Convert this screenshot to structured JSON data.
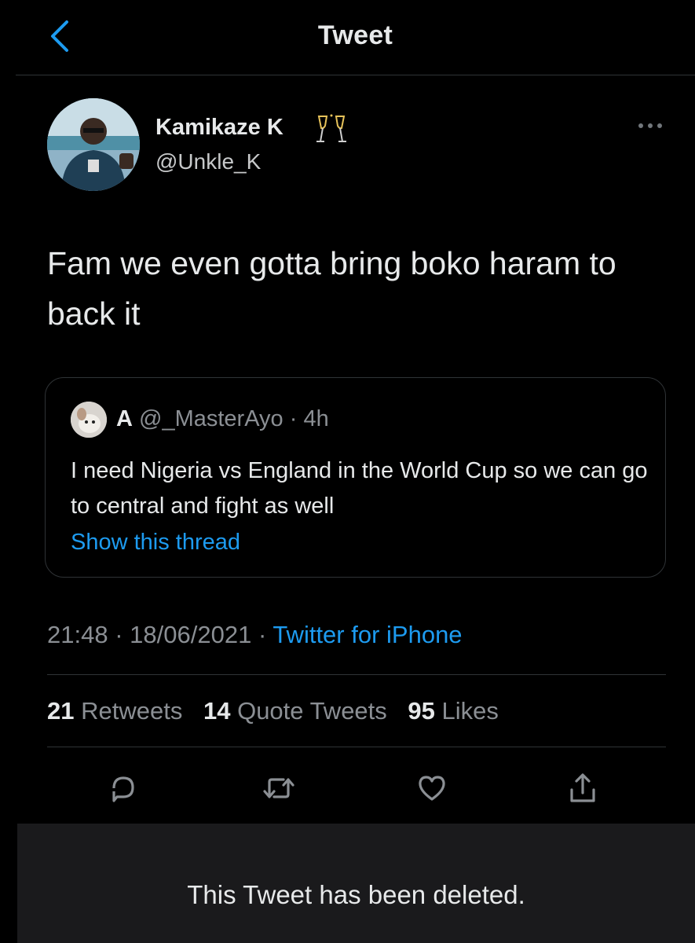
{
  "header": {
    "title": "Tweet",
    "back_icon": "chevron-left-icon",
    "accent": "#1d9bf0"
  },
  "author": {
    "name": "Kamikaze K",
    "handle": "@Unkle_K",
    "emoji_icon": "clinking-glasses-icon"
  },
  "tweet": {
    "text": "Fam we even gotta bring boko haram to back it"
  },
  "quote": {
    "name": "A",
    "handle": "@_MasterAyo",
    "separator": "·",
    "age": "4h",
    "text": "I need Nigeria vs England in the World Cup so we can go to central and fight as well",
    "link": "Show this thread"
  },
  "meta": {
    "time": "21:48",
    "separator": "·",
    "date": "18/06/2021",
    "source": "Twitter for iPhone"
  },
  "stats": {
    "retweets_count": "21",
    "retweets_label": "Retweets",
    "quotes_count": "14",
    "quotes_label": "Quote Tweets",
    "likes_count": "95",
    "likes_label": "Likes"
  },
  "actions": [
    "reply-icon",
    "retweet-icon",
    "like-icon",
    "share-icon"
  ],
  "banner": {
    "text": "This Tweet has been deleted."
  }
}
